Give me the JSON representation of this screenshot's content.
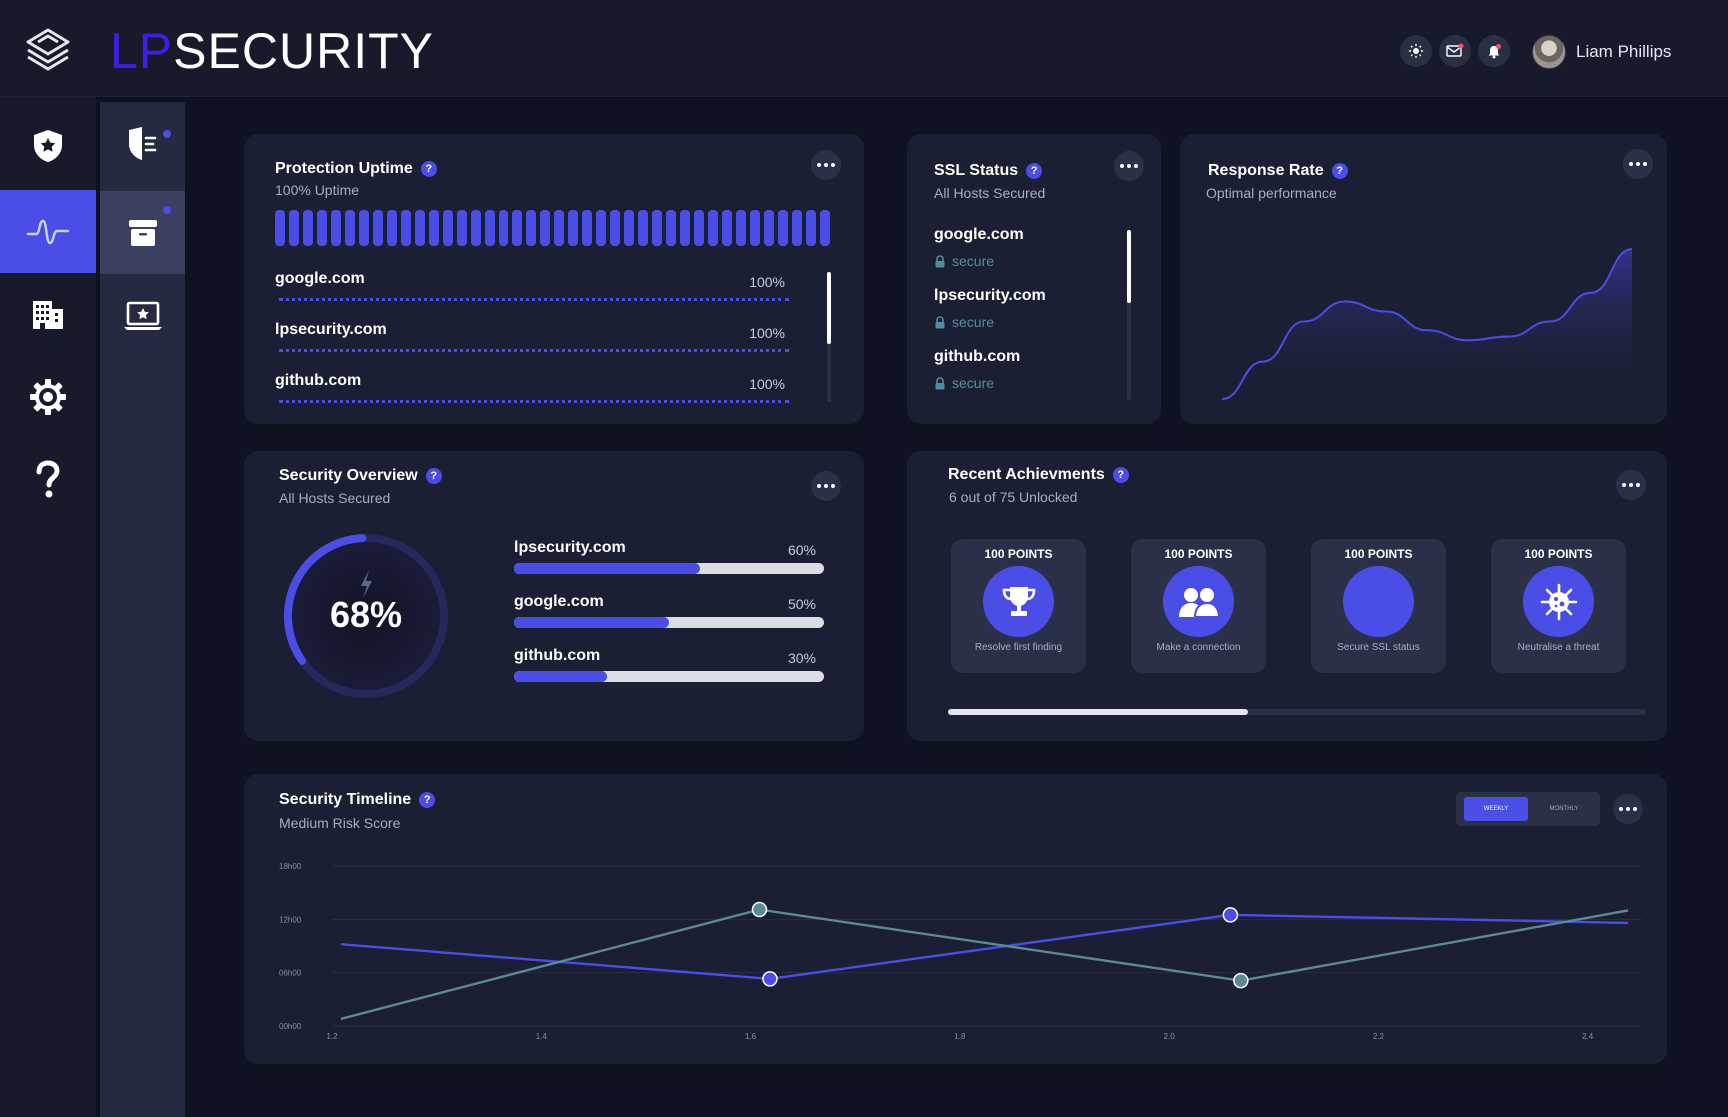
{
  "header": {
    "brand_lp": "LP",
    "brand_rest": "SECURITY",
    "user_name": "Liam Phillips"
  },
  "colors": {
    "accent": "#4a4de6",
    "brand_lp": "#3d1ee6",
    "teal": "#5a8a96",
    "card": "#1b1f33",
    "background": "#0f1220"
  },
  "rail": [
    "shield-star-icon",
    "activity-wave-icon",
    "building-icon",
    "gear-icon",
    "question-icon"
  ],
  "sub_rail": [
    "shield-list-icon",
    "archive-icon",
    "laptop-star-icon"
  ],
  "uptime": {
    "title": "Protection Uptime",
    "subtitle": "100% Uptime",
    "hosts": [
      {
        "host": "google.com",
        "pct": "100%"
      },
      {
        "host": "lpsecurity.com",
        "pct": "100%"
      },
      {
        "host": "github.com",
        "pct": "100%"
      }
    ]
  },
  "ssl": {
    "title": "SSL Status",
    "subtitle": "All Hosts Secured",
    "hosts": [
      {
        "host": "google.com",
        "status": "secure"
      },
      {
        "host": "lpsecurity.com",
        "status": "secure"
      },
      {
        "host": "github.com",
        "status": "secure"
      }
    ]
  },
  "response": {
    "title": "Response Rate",
    "subtitle": "Optimal performance"
  },
  "overview": {
    "title": "Security Overview",
    "subtitle": "All Hosts Secured",
    "score": "68%",
    "score_value": 68,
    "hosts": [
      {
        "host": "lpsecurity.com",
        "pct": "60%",
        "value": 60
      },
      {
        "host": "google.com",
        "pct": "50%",
        "value": 50
      },
      {
        "host": "github.com",
        "pct": "30%",
        "value": 30
      }
    ]
  },
  "achievements": {
    "title": "Recent Achievments",
    "subtitle": "6 out of 75 Unlocked",
    "scroll_fraction": 0.43,
    "items": [
      {
        "points": "100 POINTS",
        "label": "Resolve first finding",
        "icon": "trophy-icon"
      },
      {
        "points": "100 POINTS",
        "label": "Make a connection",
        "icon": "users-icon"
      },
      {
        "points": "100 POINTS",
        "label": "Secure SSL status",
        "icon": "blank-badge-icon"
      },
      {
        "points": "100 POINTS",
        "label": "Neutralise a threat",
        "icon": "virus-icon"
      }
    ]
  },
  "timeline": {
    "title": "Security Timeline",
    "subtitle": "Medium Risk Score",
    "toggle_on": "WEEKLY",
    "toggle_off": "MONTHLY"
  },
  "chart_data": [
    {
      "type": "area",
      "title": "Response Rate",
      "x": [
        0,
        1,
        2,
        3,
        4,
        5,
        6,
        7,
        8,
        9,
        10
      ],
      "values": [
        0.0,
        0.3,
        0.62,
        0.78,
        0.7,
        0.55,
        0.47,
        0.5,
        0.62,
        0.85,
        1.2
      ],
      "ylim": [
        0,
        1.2
      ],
      "grid": false
    },
    {
      "type": "line",
      "title": "Security Timeline",
      "y_ticks": [
        "00h00",
        "06h00",
        "12h00",
        "18h00"
      ],
      "y_tick_values": [
        0,
        6,
        12,
        18
      ],
      "x_ticks": [
        "1.2",
        "1.4",
        "1.6",
        "1.8",
        "2.0",
        "2.2",
        "2.4"
      ],
      "x_tick_values": [
        1.2,
        1.4,
        1.6,
        1.8,
        2.0,
        2.2,
        2.4
      ],
      "xlim": [
        1.2,
        2.45
      ],
      "ylim": [
        0,
        18
      ],
      "grid": true,
      "series": [
        {
          "color": "#4a4de6",
          "x": [
            1.22,
            1.63,
            2.07,
            2.45
          ],
          "values": [
            9.2,
            5.3,
            12.5,
            11.6
          ],
          "markers": [
            1,
            2
          ]
        },
        {
          "color": "#5a8a96",
          "x": [
            1.22,
            1.62,
            2.08,
            2.45
          ],
          "values": [
            0.8,
            13.1,
            5.1,
            13.0
          ],
          "markers": [
            1,
            2
          ]
        }
      ]
    }
  ]
}
